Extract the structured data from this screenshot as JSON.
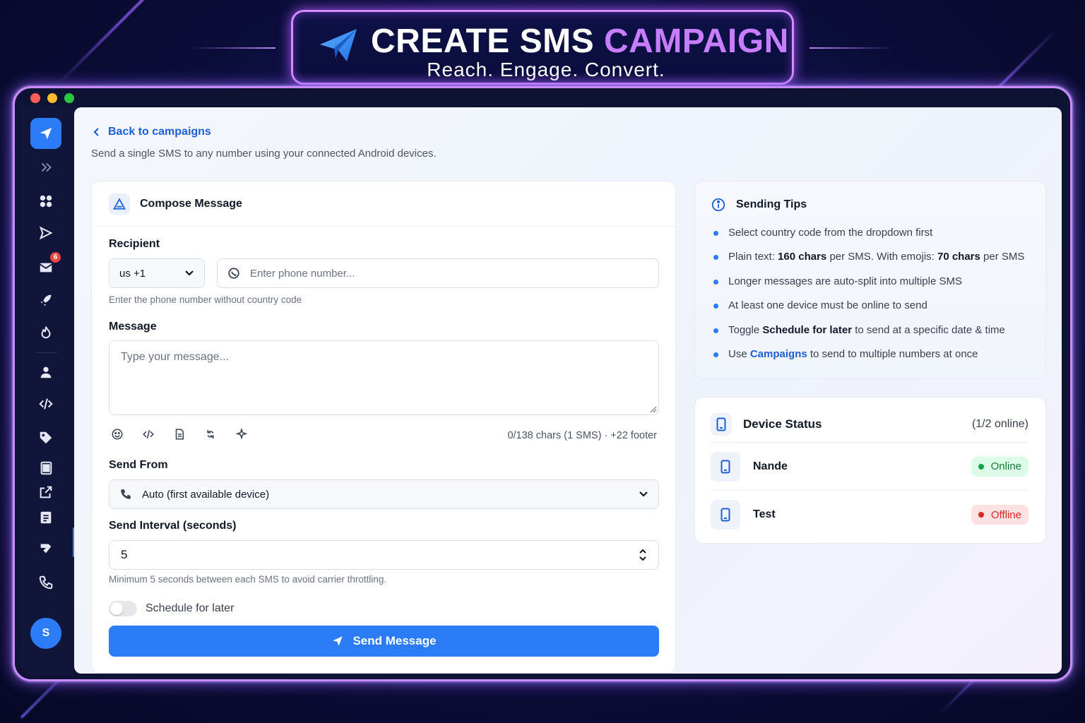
{
  "banner": {
    "title_main": "CREATE SMS",
    "title_accent": "CAMPAIGN",
    "subtitle": "Reach. Engage. Convert."
  },
  "colors": {
    "primary": "#2b7cf6",
    "accent_purple": "#c77dff",
    "online": "#16a34a",
    "offline": "#dc2626"
  },
  "sidebar": {
    "icons": [
      "paper-plane-icon",
      "expand-icon",
      "dashboard-icon",
      "send-icon",
      "inbox-icon",
      "rocket-icon",
      "fire-icon",
      "contacts-icon",
      "code-icon",
      "tag-icon",
      "templates-icon",
      "external-link-icon",
      "logs-icon",
      "integrations-icon",
      "phone-icon"
    ],
    "inbox_badge": "6",
    "avatar_initial": "S"
  },
  "page": {
    "back_label": "Back to campaigns",
    "subtitle": "Send a single SMS to any number using your connected Android devices."
  },
  "compose": {
    "title": "Compose Message",
    "recipient_label": "Recipient",
    "country_code": "us +1",
    "phone_placeholder": "Enter phone number...",
    "phone_hint": "Enter the phone number without country code",
    "message_label": "Message",
    "message_placeholder": "Type your message...",
    "toolbar_icons": [
      "emoji-icon",
      "code-icon",
      "template-icon",
      "refresh-icon",
      "sparkle-icon"
    ],
    "counter": "0/138 chars (1 SMS) · +22 footer",
    "send_from_label": "Send From",
    "send_from_value": "Auto (first available device)",
    "interval_label": "Send Interval (seconds)",
    "interval_value": "5",
    "interval_hint": "Minimum 5 seconds between each SMS to avoid carrier throttling.",
    "schedule_label": "Schedule for later",
    "schedule_enabled": false,
    "send_label": "Send Message"
  },
  "tips": {
    "title": "Sending Tips",
    "items": [
      {
        "pre": "Select country code from the dropdown first",
        "bold": "",
        "post": ""
      },
      {
        "pre": "Plain text: ",
        "bold": "160 chars",
        "post": " per SMS. With emojis: ",
        "bold2": "70 chars",
        "post2": " per SMS"
      },
      {
        "pre": "Longer messages are auto-split into multiple SMS",
        "bold": "",
        "post": ""
      },
      {
        "pre": "At least one device must be online to send",
        "bold": "",
        "post": ""
      },
      {
        "pre": "Toggle ",
        "bold": "Schedule for later",
        "post": " to send at a specific date & time"
      },
      {
        "pre": "Use ",
        "link": "Campaigns",
        "post": " to send to multiple numbers at once"
      }
    ]
  },
  "devices": {
    "title": "Device Status",
    "count": "(1/2 online)",
    "list": [
      {
        "name": "Nande",
        "status": "Online"
      },
      {
        "name": "Test",
        "status": "Offline"
      }
    ]
  }
}
